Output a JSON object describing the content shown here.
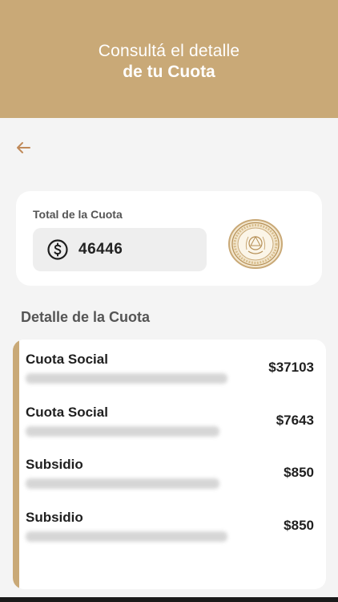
{
  "header": {
    "line1": "Consultá el detalle",
    "line2": "de tu Cuota"
  },
  "nav": {
    "back_icon": "arrow-left-icon"
  },
  "total": {
    "label": "Total de la Cuota",
    "currency_icon": "dollar-circle-icon",
    "value": "46446",
    "seal_icon": "circulo-militar-seal"
  },
  "detail": {
    "title": "Detalle de la Cuota",
    "items": [
      {
        "name": "Cuota Social",
        "amount": "$37103"
      },
      {
        "name": "Cuota Social",
        "amount": "$7643"
      },
      {
        "name": "Subsidio",
        "amount": "$850"
      },
      {
        "name": "Subsidio",
        "amount": "$850"
      }
    ]
  },
  "colors": {
    "brand": "#c9a977",
    "background": "#f4f4f4",
    "card": "#ffffff",
    "input_bg": "#eeeeee",
    "text_dark": "#1f1f1f",
    "text_muted": "#555555",
    "back_arrow": "#c08a5a"
  }
}
